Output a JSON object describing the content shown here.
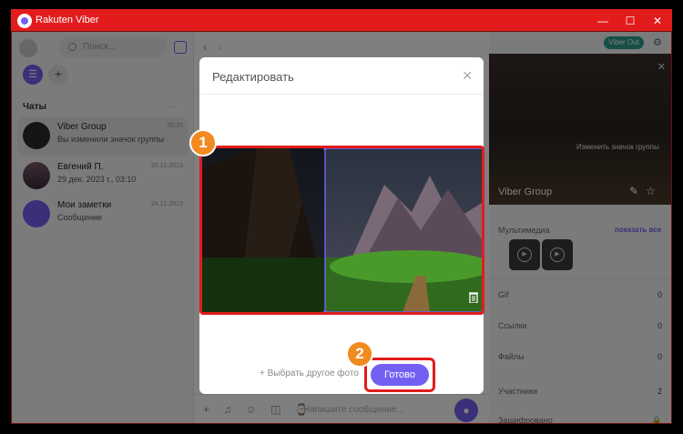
{
  "window": {
    "title": "Rakuten Viber",
    "controls": [
      "—",
      "☐",
      "✕"
    ]
  },
  "sidebar": {
    "search_placeholder": "Поиск...",
    "chats_label": "Чаты",
    "chats_more": "···",
    "chats": [
      {
        "name": "Viber Group",
        "message": "Вы изменили значок группы",
        "time": "00:25"
      },
      {
        "name": "Евгений П.",
        "message": "29 дек. 2023 г., 03:10",
        "time": "20.12.2023"
      },
      {
        "name": "Мои заметки",
        "message": "Сообщение",
        "time": "24.12.2023"
      }
    ]
  },
  "composer": {
    "placeholder": "Напишите сообщение..."
  },
  "right_panel": {
    "viber_out": "Viber Out",
    "change_icon": "Изменить значок группы",
    "group_name": "Viber Group",
    "media_label": "Мультимедиа",
    "show_all": "показать все",
    "rows": [
      {
        "label": "Gif",
        "count": "0"
      },
      {
        "label": "Ссылки",
        "count": "0"
      },
      {
        "label": "Файлы",
        "count": "0"
      },
      {
        "label": "Участники",
        "count": "2"
      },
      {
        "label": "Зашифровано",
        "count": ""
      }
    ]
  },
  "dialog": {
    "title": "Редактировать",
    "choose_other": "+ Выбрать другое фото",
    "done": "Готово"
  },
  "callouts": {
    "first": "1",
    "second": "2"
  },
  "colors": {
    "accent": "#7360f2",
    "title_bar": "#e21c1c",
    "callout": "#f28a1f",
    "viber_out": "#2f9c90"
  }
}
